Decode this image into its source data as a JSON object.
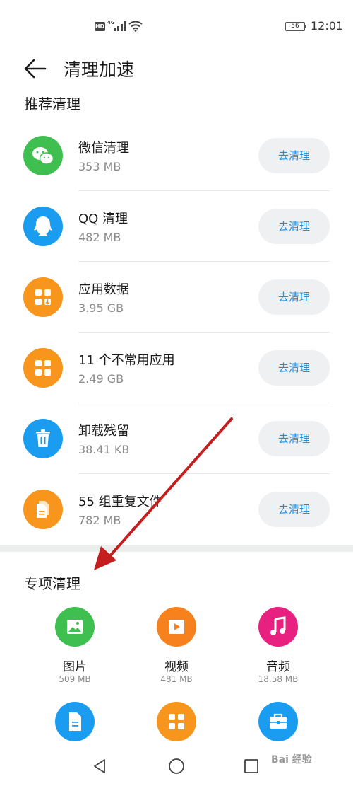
{
  "status_bar": {
    "hd": "HD",
    "network": "4G",
    "battery": "56",
    "time": "12:01"
  },
  "header": {
    "title": "清理加速"
  },
  "recommended": {
    "title": "推荐清理",
    "items": [
      {
        "title": "微信清理",
        "size": "353 MB",
        "button": "去清理",
        "icon": "wechat-icon",
        "color": "#3fbf4f"
      },
      {
        "title": "QQ 清理",
        "size": "482 MB",
        "button": "去清理",
        "icon": "qq-icon",
        "color": "#1a9cf0"
      },
      {
        "title": "应用数据",
        "size": "3.95 GB",
        "button": "去清理",
        "icon": "app-data-icon",
        "color": "#f7951d"
      },
      {
        "title": "11 个不常用应用",
        "size": "2.49 GB",
        "button": "去清理",
        "icon": "apps-grid-icon",
        "color": "#f7951d"
      },
      {
        "title": "卸载残留",
        "size": "38.41 KB",
        "button": "去清理",
        "icon": "trash-icon",
        "color": "#1a9cf0"
      },
      {
        "title": "55 组重复文件",
        "size": "782 MB",
        "button": "去清理",
        "icon": "duplicate-file-icon",
        "color": "#f7951d"
      }
    ]
  },
  "special": {
    "title": "专项清理",
    "items": [
      {
        "label": "图片",
        "size": "509 MB",
        "icon": "picture-icon",
        "color": "#3fbf4f"
      },
      {
        "label": "视频",
        "size": "481 MB",
        "icon": "video-icon",
        "color": "#f7821d"
      },
      {
        "label": "音频",
        "size": "18.58 MB",
        "icon": "music-icon",
        "color": "#e8207f"
      },
      {
        "label": "",
        "size": "",
        "icon": "document-icon",
        "color": "#1a9cf0"
      },
      {
        "label": "",
        "size": "",
        "icon": "apps-grid-icon",
        "color": "#f7951d"
      },
      {
        "label": "",
        "size": "",
        "icon": "briefcase-icon",
        "color": "#1a9cf0"
      }
    ]
  },
  "watermark": "Bai 经验"
}
